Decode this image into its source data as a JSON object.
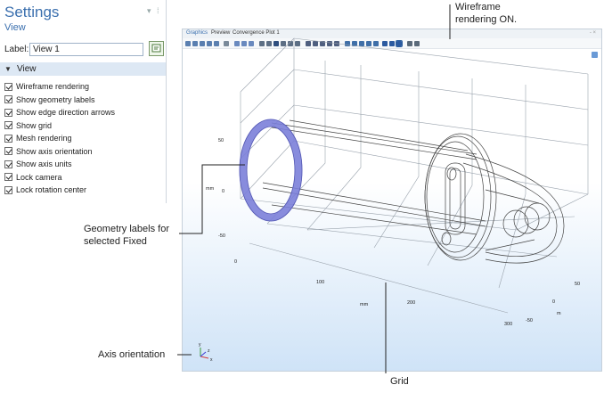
{
  "settings": {
    "title": "Settings",
    "subtitle": "View",
    "label_caption": "Label:",
    "label_value": "View 1",
    "section": "View",
    "checkboxes": [
      {
        "label": "Wireframe rendering",
        "checked": true
      },
      {
        "label": "Show geometry labels",
        "checked": true
      },
      {
        "label": "Show edge direction arrows",
        "checked": true
      },
      {
        "label": "Show grid",
        "checked": true
      },
      {
        "label": "Mesh rendering",
        "checked": true
      },
      {
        "label": "Show axis orientation",
        "checked": true
      },
      {
        "label": "Show axis units",
        "checked": true
      },
      {
        "label": "Lock camera",
        "checked": true
      },
      {
        "label": "Lock rotation center",
        "checked": true
      }
    ]
  },
  "graphics": {
    "tabs": [
      "Graphics",
      "Preview",
      "Convergence Plot 1"
    ],
    "active_tab": "Graphics",
    "tabs_close": "- ×",
    "axis_ticks": {
      "z": [
        "50",
        "0",
        "-50"
      ],
      "z_unit": "mm",
      "x": [
        "0",
        "100",
        "200",
        "300"
      ],
      "x_unit": "mm",
      "y": [
        "50",
        "0",
        "-50"
      ],
      "y_unit": "m"
    },
    "triad": {
      "y": "y",
      "z": "z",
      "x": "x"
    },
    "selection_color": "#7b7fd9"
  },
  "callouts": {
    "wireframe": [
      "Wireframe",
      "rendering ON."
    ],
    "geometry_labels": [
      "Geometry labels for",
      "selected Fixed"
    ],
    "axis_orientation": "Axis orientation",
    "grid": "Grid"
  }
}
